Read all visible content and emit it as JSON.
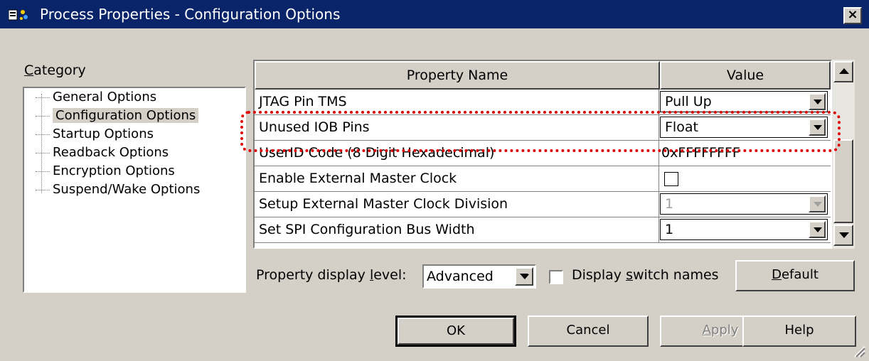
{
  "window": {
    "title": "Process Properties - Configuration Options",
    "close_label": "×"
  },
  "category": {
    "label": "Category",
    "items": [
      {
        "label": "General Options",
        "selected": false
      },
      {
        "label": "Configuration Options",
        "selected": true
      },
      {
        "label": "Startup Options",
        "selected": false
      },
      {
        "label": "Readback Options",
        "selected": false
      },
      {
        "label": "Encryption Options",
        "selected": false
      },
      {
        "label": "Suspend/Wake Options",
        "selected": false
      }
    ]
  },
  "grid": {
    "headers": {
      "name": "Property Name",
      "value": "Value"
    },
    "rows": [
      {
        "name": "JTAG Pin TMS",
        "value": "Pull Up",
        "kind": "dropdown"
      },
      {
        "name": "Unused IOB Pins",
        "value": "Float",
        "kind": "dropdown"
      },
      {
        "name": "UserID Code (8 Digit Hexadecimal)",
        "value": "0xFFFFFFFF",
        "kind": "text"
      },
      {
        "name": "Enable External Master Clock",
        "value": "",
        "kind": "checkbox",
        "checked": false
      },
      {
        "name": "Setup External Master Clock Division",
        "value": "1",
        "kind": "dropdown-disabled"
      },
      {
        "name": "Set SPI Configuration Bus Width",
        "value": "1",
        "kind": "dropdown"
      }
    ]
  },
  "controls": {
    "level_label": "Property display level:",
    "level_value": "Advanced",
    "switch_label": "Display switch names",
    "default_label": "Default"
  },
  "buttons": {
    "ok": "OK",
    "cancel": "Cancel",
    "apply": "Apply",
    "help": "Help"
  },
  "colors": {
    "titlebar": "#0a246a",
    "face": "#d4d0c8",
    "highlight": "#e00000"
  }
}
